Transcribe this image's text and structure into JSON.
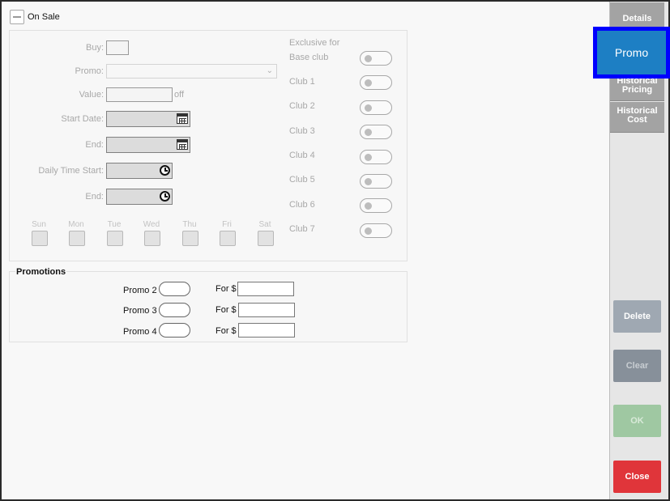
{
  "on_sale": {
    "label": "On Sale"
  },
  "form": {
    "buy_label": "Buy:",
    "promo_label": "Promo:",
    "value_label": "Value:",
    "value_suffix": "off",
    "start_date_label": "Start Date:",
    "end_date_label": "End:",
    "daily_time_start_label": "Daily Time Start:",
    "end_time_label": "End:",
    "days": [
      "Sun",
      "Mon",
      "Tue",
      "Wed",
      "Thu",
      "Fri",
      "Sat"
    ]
  },
  "clubs": {
    "exclusive_label": "Exclusive for",
    "items": [
      "Base club",
      "Club 1",
      "Club 2",
      "Club 3",
      "Club 4",
      "Club 5",
      "Club 6",
      "Club 7"
    ]
  },
  "promotions": {
    "title": "Promotions",
    "rows": [
      {
        "label": "Promo 2",
        "for_label": "For $"
      },
      {
        "label": "Promo 3",
        "for_label": "For $"
      },
      {
        "label": "Promo 4",
        "for_label": "For $"
      }
    ]
  },
  "sidebar": {
    "tabs": [
      "Details",
      "Promo",
      "Historical Pricing",
      "Historical Cost"
    ],
    "active_tab": "Promo",
    "actions": [
      {
        "label": "Delete",
        "color": "#9fa8b2"
      },
      {
        "label": "Clear",
        "color": "#87909a"
      },
      {
        "label": "OK",
        "color": "#9fc8a2"
      },
      {
        "label": "Close",
        "color": "#e0353a"
      }
    ]
  },
  "colors": {
    "active_tab_bg": "#1d7fc4",
    "active_tab_border": "#0000ff"
  }
}
